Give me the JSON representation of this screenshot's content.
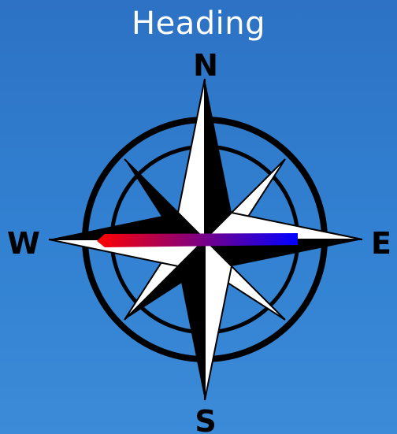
{
  "header": {
    "title": "Heading"
  },
  "compass": {
    "cardinals": {
      "north": "N",
      "south": "S",
      "east": "E",
      "west": "W"
    },
    "needle": {
      "tail_color": "#ff0000",
      "head_color": "#0000ff"
    },
    "star_dark": "#000000",
    "star_light": "#ffffff"
  }
}
